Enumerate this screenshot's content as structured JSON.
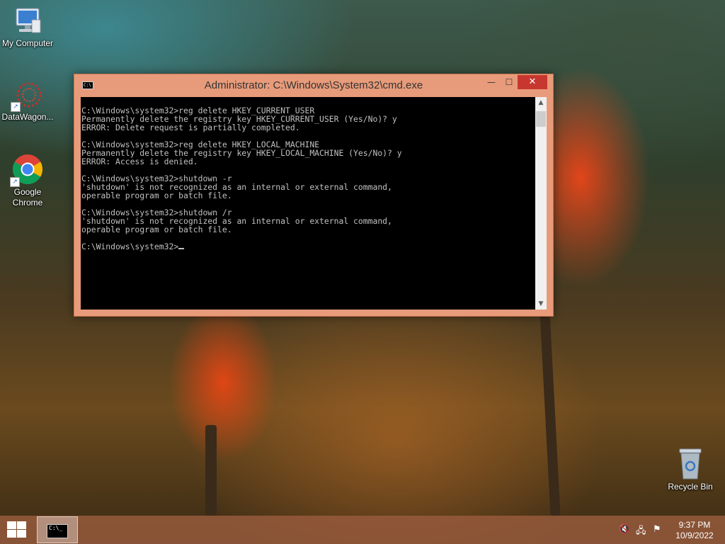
{
  "desktop": {
    "icons": [
      {
        "label": "My Computer",
        "icon": "computer-icon"
      },
      {
        "label": "DataWagon...",
        "icon": "datawagon-icon"
      },
      {
        "label_line1": "Google",
        "label_line2": "Chrome",
        "icon": "chrome-icon"
      },
      {
        "label": "Recycle Bin",
        "icon": "recycle-bin-icon"
      }
    ]
  },
  "window": {
    "title": "Administrator: C:\\Windows\\System32\\cmd.exe",
    "icon_text": "C:\\",
    "minimize": "—",
    "maximize": "☐",
    "close": "✕",
    "console_lines": [
      "C:\\Windows\\system32>reg delete HKEY_CURRENT_USER",
      "Permanently delete the registry key HKEY_CURRENT_USER (Yes/No)? y",
      "ERROR: Delete request is partially completed.",
      "",
      "C:\\Windows\\system32>reg delete HKEY_LOCAL_MACHINE",
      "Permanently delete the registry key HKEY_LOCAL_MACHINE (Yes/No)? y",
      "ERROR: Access is denied.",
      "",
      "C:\\Windows\\system32>shutdown -r",
      "'shutdown' is not recognized as an internal or external command,",
      "operable program or batch file.",
      "",
      "C:\\Windows\\system32>shutdown /r",
      "'shutdown' is not recognized as an internal or external command,",
      "operable program or batch file.",
      ""
    ],
    "prompt": "C:\\Windows\\system32>",
    "scroll_up": "▲",
    "scroll_down": "▼"
  },
  "taskbar": {
    "task_icon_text": "C:\\_",
    "tray": {
      "volume_icon": "🔇",
      "network_icon": "🖧",
      "flag_icon": "⚑"
    },
    "time": "9:37 PM",
    "date": "10/9/2022"
  },
  "colors": {
    "window_frame": "#e89b7a",
    "close_button": "#c7372f",
    "console_bg": "#000000",
    "console_fg": "#c0c0c0"
  }
}
